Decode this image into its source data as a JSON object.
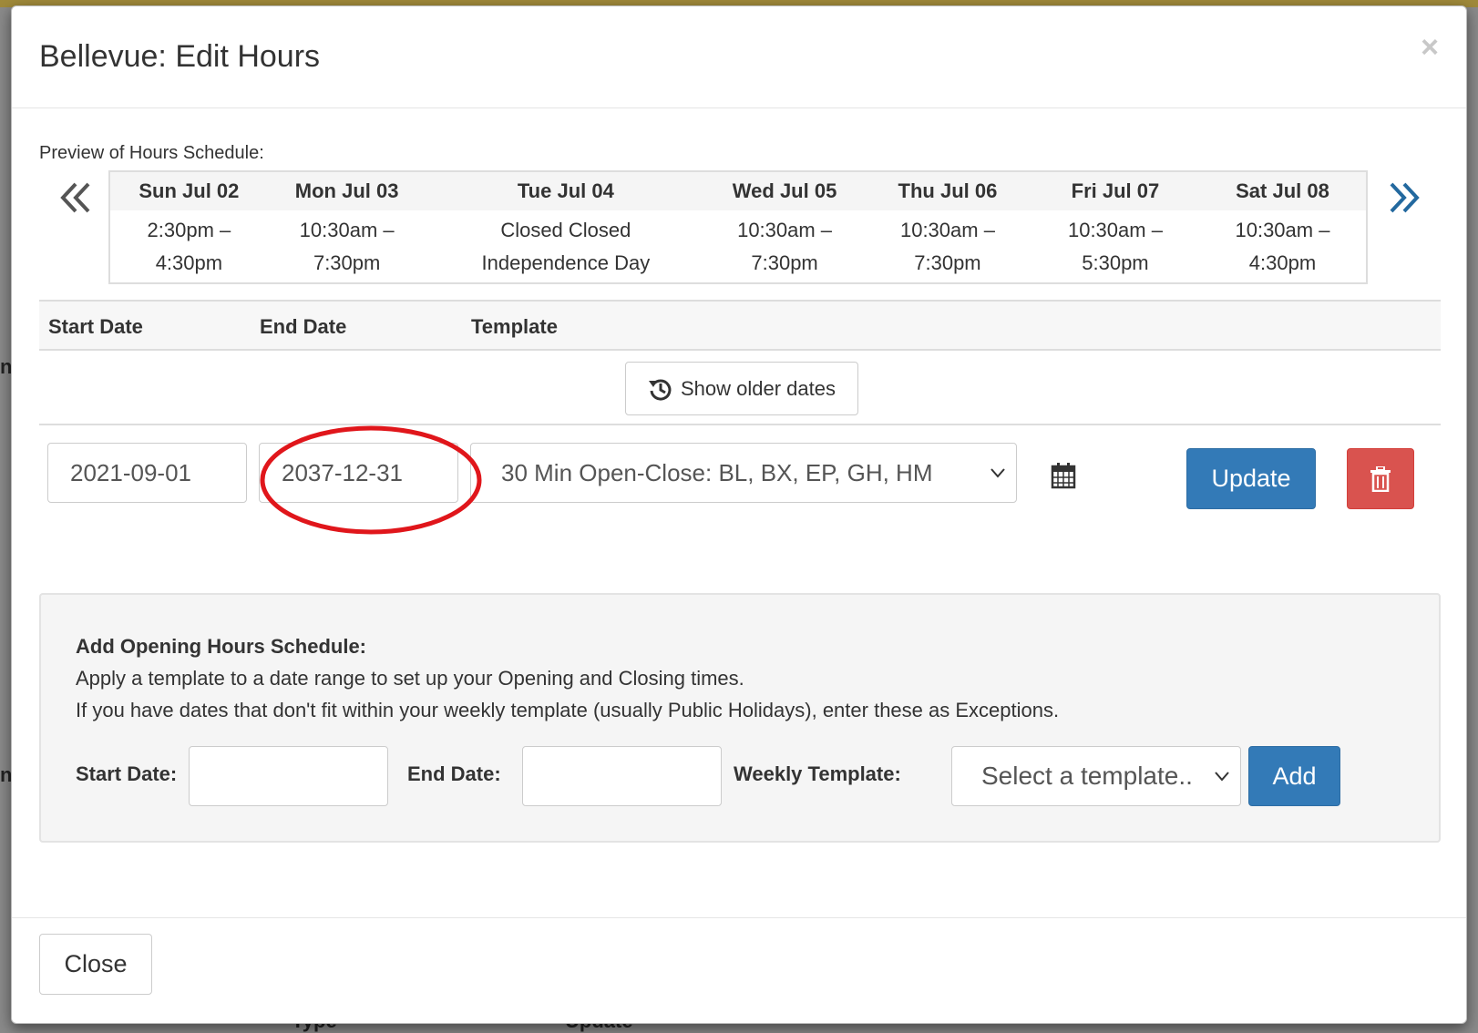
{
  "modal": {
    "title": "Bellevue: Edit Hours",
    "close_symbol": "×"
  },
  "preview": {
    "label": "Preview of Hours Schedule:",
    "prev_icon": "double-chevron-left-icon",
    "next_icon": "double-chevron-right-icon",
    "days": [
      {
        "header": "Sun Jul 02",
        "line1": "2:30pm –",
        "line2": "4:30pm"
      },
      {
        "header": "Mon Jul 03",
        "line1": "10:30am –",
        "line2": "7:30pm"
      },
      {
        "header": "Tue Jul 04",
        "line1": "Closed Closed",
        "line2": "Independence Day"
      },
      {
        "header": "Wed Jul 05",
        "line1": "10:30am –",
        "line2": "7:30pm"
      },
      {
        "header": "Thu Jul 06",
        "line1": "10:30am –",
        "line2": "7:30pm"
      },
      {
        "header": "Fri Jul 07",
        "line1": "10:30am –",
        "line2": "5:30pm"
      },
      {
        "header": "Sat Jul 08",
        "line1": "10:30am –",
        "line2": "4:30pm"
      }
    ]
  },
  "schedule": {
    "columns": {
      "start": "Start Date",
      "end": "End Date",
      "template": "Template"
    },
    "older_button": "Show older dates",
    "row": {
      "start_date": "2021-09-01",
      "end_date": "2037-12-31",
      "template": "30 Min Open-Close: BL, BX, EP, GH, HM",
      "update_label": "Update"
    }
  },
  "add_panel": {
    "title": "Add Opening Hours Schedule:",
    "desc1": "Apply a template to a date range to set up your Opening and Closing times.",
    "desc2": "If you have dates that don't fit within your weekly template (usually Public Holidays), enter these as Exceptions.",
    "start_label": "Start Date:",
    "end_label": "End Date:",
    "template_label": "Weekly Template:",
    "template_placeholder": "Select a template..",
    "add_label": "Add"
  },
  "footer": {
    "close_label": "Close"
  },
  "background": {
    "fragments": [
      "n",
      "n",
      "Type",
      "Update"
    ]
  },
  "colors": {
    "primary": "#337ab7",
    "danger": "#d9534f",
    "annotation": "#e0161b",
    "nav_prev": "#555555",
    "nav_next": "#23699f"
  }
}
